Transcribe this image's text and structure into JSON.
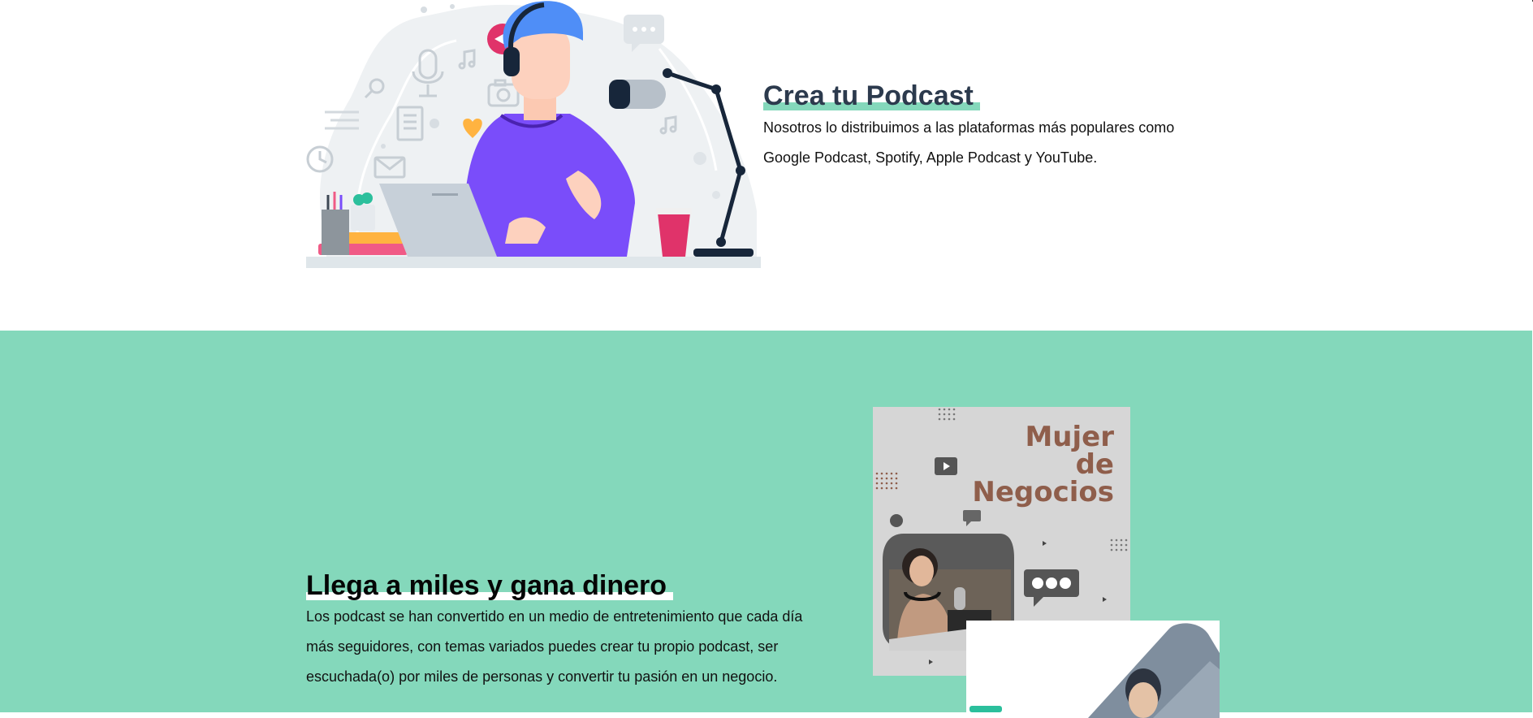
{
  "section_podcast": {
    "title": "Crea tu Podcast",
    "line1": "Nosotros lo distribuimos a las plataformas más populares como",
    "line2": "Google Podcast, Spotify, Apple Podcast y YouTube."
  },
  "section_earn": {
    "title": "Llega a miles y gana dinero",
    "line1": "Los podcast se han convertido en un medio de entretenimiento que cada día",
    "line2": "más seguidores, con temas variados puedes crear tu propio podcast, ser",
    "line3": "escuchada(o) por miles de personas y convertir tu pasión en un negocio."
  },
  "business_card": {
    "line1": "Mujer",
    "line2": "de",
    "line3": "Negocios"
  },
  "colors": {
    "accent_mint": "#84d8bb",
    "heading_navy": "#2c3a4d",
    "shirt_purple": "#7a4dfa",
    "hair_blue": "#4f8ef7",
    "badge_pink": "#e0336a",
    "card_brown": "#8f5e4b"
  },
  "icons": [
    "play-badge-icon",
    "chat-bubble-icon",
    "microphone-icon",
    "camera-icon",
    "music-note-icon",
    "envelope-icon",
    "clock-icon",
    "heart-icon",
    "search-icon",
    "document-icon",
    "video-play-icon",
    "speech-bubble-icon"
  ]
}
